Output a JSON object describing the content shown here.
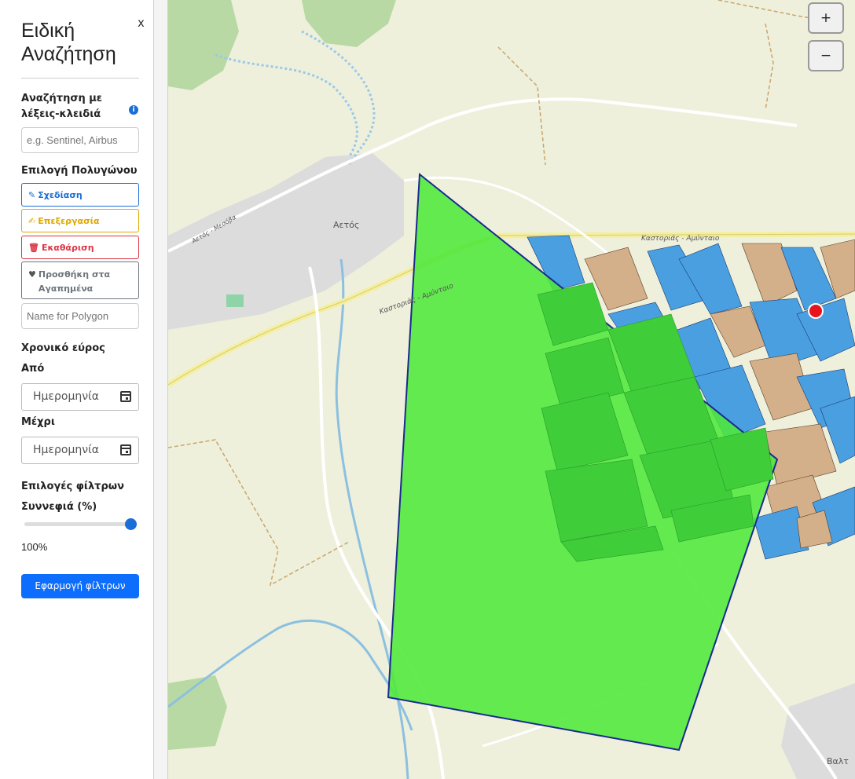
{
  "sidebar": {
    "title": "Ειδική Αναζήτηση",
    "close_label": "x",
    "keyword_label": "Αναζήτηση με λέξεις-κλειδιά",
    "keyword_placeholder": "e.g. Sentinel, Airbus",
    "polygon_label": "Επιλογή Πολυγώνου",
    "draw_label": "Σχεδίαση",
    "edit_label": "Επεξεργασία",
    "clear_label": "Εκαθάριση",
    "favorite_label": "Προσθήκη στα Αγαπημένα",
    "polygon_name_placeholder": "Name for Polygon",
    "time_range_label": "Χρονικό εύρος",
    "from_label": "Από",
    "to_label": "Μέχρι",
    "date_placeholder": "Ημερομηνία",
    "filter_options_label": "Επιλογές φίλτρων",
    "cloud_cover_label": "Συννεφιά (%)",
    "cloud_cover_value": "100%",
    "cloud_cover_fraction": 1.0,
    "apply_label": "Εφαρμογή φίλτρων"
  },
  "map": {
    "place_aetos": "Αετός",
    "place_valtonera": "Βαλτ",
    "road_kastorias": "Καστοριάς - Αμύνταιο",
    "road_kastorias_2": "Καστοριάς - Αμύνταιο",
    "road_aetos": "Αετός - Μεσόβα",
    "zoom_in": "+",
    "zoom_out": "−",
    "polygon_fill": "#4ee83a",
    "polygon_stroke": "#1a2a8f",
    "parcel_blue": "#4a9fe0",
    "parcel_tan": "#d4b08a",
    "marker_color": "#e8141c"
  },
  "colors": {
    "primary": "#0d6efd",
    "draw": "#1a6fd6",
    "edit": "#e0a800",
    "clear": "#dc3545",
    "favorite": "#6c757d"
  }
}
